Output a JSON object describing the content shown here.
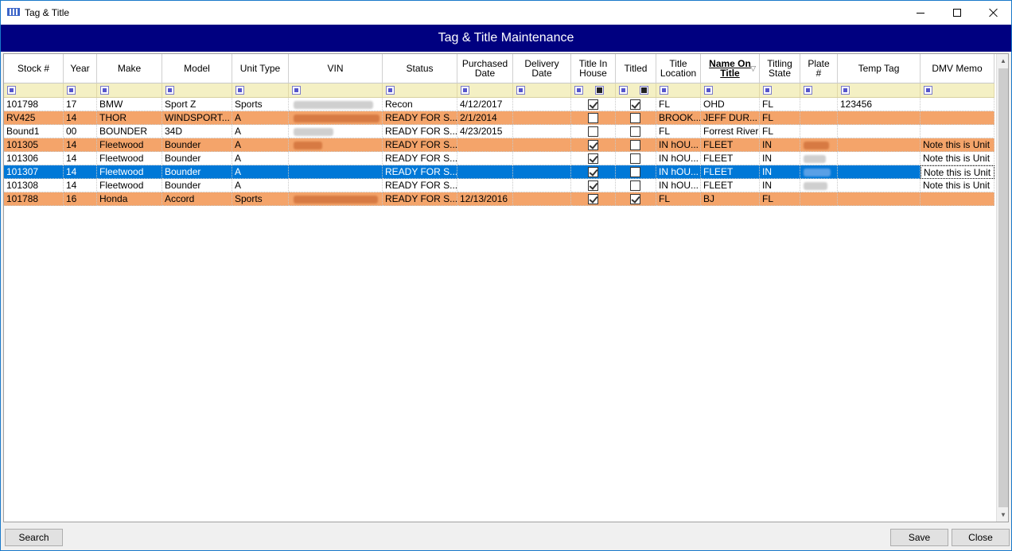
{
  "window": {
    "title": "Tag & Title"
  },
  "banner": {
    "title": "Tag & Title Maintenance"
  },
  "columns": [
    {
      "key": "stock",
      "label": "Stock #"
    },
    {
      "key": "year",
      "label": "Year"
    },
    {
      "key": "make",
      "label": "Make"
    },
    {
      "key": "model",
      "label": "Model"
    },
    {
      "key": "unit_type",
      "label": "Unit Type"
    },
    {
      "key": "vin",
      "label": "VIN"
    },
    {
      "key": "status",
      "label": "Status"
    },
    {
      "key": "purchased_date",
      "label": "Purchased Date"
    },
    {
      "key": "delivery_date",
      "label": "Delivery Date"
    },
    {
      "key": "title_in_house",
      "label": "Title In House"
    },
    {
      "key": "titled",
      "label": "Titled"
    },
    {
      "key": "title_location",
      "label": "Title Location"
    },
    {
      "key": "name_on_title",
      "label": "Name On Title",
      "sorted": true
    },
    {
      "key": "titling_state",
      "label": "Titling State"
    },
    {
      "key": "plate",
      "label": "Plate #"
    },
    {
      "key": "temp_tag",
      "label": "Temp Tag"
    },
    {
      "key": "dmv_memo",
      "label": "DMV Memo"
    }
  ],
  "rows": [
    {
      "style": "white",
      "stock": "101798",
      "year": "17",
      "make": "BMW",
      "model": "Sport Z",
      "unit_type": "Sports",
      "vin_redacted": true,
      "status": "Recon",
      "purchased_date": "4/12/2017",
      "delivery_date": "",
      "title_in_house": true,
      "titled": true,
      "title_location": "FL",
      "name_on_title": "OHD",
      "titling_state": "FL",
      "plate": "",
      "plate_redacted": false,
      "temp_tag": "123456",
      "dmv_memo": ""
    },
    {
      "style": "orange",
      "stock": "RV425",
      "year": "14",
      "make": "THOR",
      "model": "WINDSPORT...",
      "unit_type": "A",
      "vin_redacted": true,
      "status": "READY FOR S...",
      "purchased_date": "2/1/2014",
      "delivery_date": "",
      "title_in_house": false,
      "titled": false,
      "title_location": "BROOK...",
      "name_on_title": "JEFF DUR...",
      "titling_state": "FL",
      "plate": "",
      "plate_redacted": false,
      "temp_tag": "",
      "dmv_memo": ""
    },
    {
      "style": "white",
      "stock": "Bound1",
      "year": "00",
      "make": "BOUNDER",
      "model": "34D",
      "unit_type": "A",
      "vin_redacted": true,
      "status": "READY FOR S...",
      "purchased_date": "4/23/2015",
      "delivery_date": "",
      "title_in_house": false,
      "titled": false,
      "title_location": "FL",
      "name_on_title": "Forrest River",
      "titling_state": "FL",
      "plate": "",
      "plate_redacted": false,
      "temp_tag": "",
      "dmv_memo": ""
    },
    {
      "style": "orange",
      "stock": "101305",
      "year": "14",
      "make": "Fleetwood",
      "model": "Bounder",
      "unit_type": "A",
      "vin_redacted": true,
      "status": "READY FOR S...",
      "purchased_date": "",
      "delivery_date": "",
      "title_in_house": true,
      "titled": false,
      "title_location": "IN hOU...",
      "name_on_title": "FLEET",
      "titling_state": "IN",
      "plate": "",
      "plate_redacted": true,
      "temp_tag": "",
      "dmv_memo": "Note this is Unit"
    },
    {
      "style": "white",
      "stock": "101306",
      "year": "14",
      "make": "Fleetwood",
      "model": "Bounder",
      "unit_type": "A",
      "vin_redacted": false,
      "status": "READY FOR S...",
      "purchased_date": "",
      "delivery_date": "",
      "title_in_house": true,
      "titled": false,
      "title_location": "IN hOU...",
      "name_on_title": "FLEET",
      "titling_state": "IN",
      "plate": "",
      "plate_redacted": true,
      "temp_tag": "",
      "dmv_memo": "Note this is Unit"
    },
    {
      "style": "selected",
      "stock": "101307",
      "year": "14",
      "make": "Fleetwood",
      "model": "Bounder",
      "unit_type": "A",
      "vin_redacted": false,
      "status": "READY FOR S...",
      "purchased_date": "",
      "delivery_date": "",
      "title_in_house": true,
      "titled": false,
      "title_location": "IN hOU...",
      "name_on_title": "FLEET",
      "titling_state": "IN",
      "plate": "",
      "plate_redacted": true,
      "temp_tag": "",
      "dmv_memo": "Note this is Unit"
    },
    {
      "style": "white",
      "stock": "101308",
      "year": "14",
      "make": "Fleetwood",
      "model": "Bounder",
      "unit_type": "A",
      "vin_redacted": false,
      "status": "READY FOR S...",
      "purchased_date": "",
      "delivery_date": "",
      "title_in_house": true,
      "titled": false,
      "title_location": "IN hOU...",
      "name_on_title": "FLEET",
      "titling_state": "IN",
      "plate": "",
      "plate_redacted": true,
      "temp_tag": "",
      "dmv_memo": "Note this is Unit"
    },
    {
      "style": "orange",
      "stock": "101788",
      "year": "16",
      "make": "Honda",
      "model": "Accord",
      "unit_type": "Sports",
      "vin_redacted": true,
      "status": "READY FOR S...",
      "purchased_date": "12/13/2016",
      "delivery_date": "",
      "title_in_house": true,
      "titled": true,
      "title_location": "FL",
      "name_on_title": "BJ",
      "titling_state": "FL",
      "plate": "",
      "plate_redacted": false,
      "temp_tag": "",
      "dmv_memo": ""
    }
  ],
  "buttons": {
    "search": "Search",
    "save": "Save",
    "close": "Close"
  },
  "colors": {
    "banner": "#000080",
    "row_orange": "#f4a46a",
    "row_selected": "#0078d7",
    "filter_row": "#f4f0c4"
  }
}
